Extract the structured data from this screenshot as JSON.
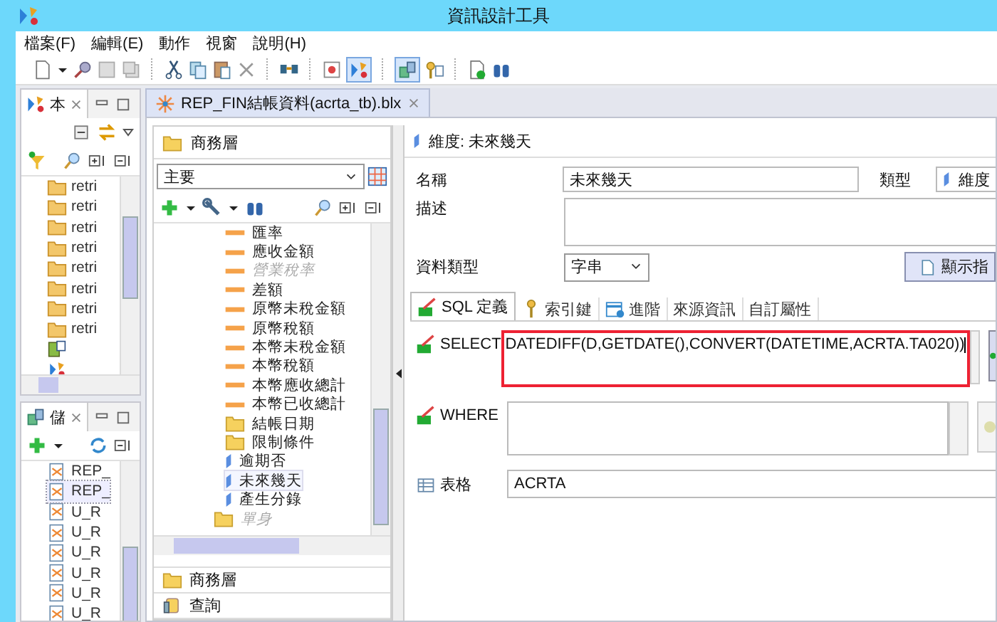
{
  "window": {
    "title": "資訊設計工具"
  },
  "menu": [
    "檔案(F)",
    "編輯(E)",
    "動作",
    "視窗",
    "說明(H)"
  ],
  "top_view": {
    "title": "本",
    "items": [
      "retri",
      "retri",
      "retri",
      "retri",
      "retri",
      "retri",
      "retri",
      "retri"
    ]
  },
  "bottom_view": {
    "title": "儲",
    "items": [
      {
        "label": "REP_",
        "selected": false
      },
      {
        "label": "REP_",
        "selected": true
      },
      {
        "label": "U_R",
        "selected": false
      },
      {
        "label": "U_R",
        "selected": false
      },
      {
        "label": "U_R",
        "selected": false
      },
      {
        "label": "U_R",
        "selected": false
      },
      {
        "label": "U_R",
        "selected": false
      },
      {
        "label": "U_R",
        "selected": false
      }
    ]
  },
  "editor_tab": {
    "label": "REP_FIN結帳資料(acrta_tb).blx"
  },
  "business_layer": {
    "title": "商務層",
    "combo": "主要",
    "tree": {
      "inner": [
        {
          "label": "匯率",
          "kind": "measure",
          "disabled": false,
          "selected": false
        },
        {
          "label": "應收金額",
          "kind": "measure",
          "disabled": false,
          "selected": false
        },
        {
          "label": "營業稅率",
          "kind": "measure",
          "disabled": true,
          "selected": false
        },
        {
          "label": "差額",
          "kind": "measure",
          "disabled": false,
          "selected": false
        },
        {
          "label": "原幣未稅金額",
          "kind": "measure",
          "disabled": false,
          "selected": false
        },
        {
          "label": "原幣稅額",
          "kind": "measure",
          "disabled": false,
          "selected": false
        },
        {
          "label": "本幣未稅金額",
          "kind": "measure",
          "disabled": false,
          "selected": false
        },
        {
          "label": "本幣稅額",
          "kind": "measure",
          "disabled": false,
          "selected": false
        },
        {
          "label": "本幣應收總計",
          "kind": "measure",
          "disabled": false,
          "selected": false
        },
        {
          "label": "本幣已收總計",
          "kind": "measure",
          "disabled": false,
          "selected": false
        },
        {
          "label": "結帳日期",
          "kind": "folder",
          "disabled": false,
          "selected": false
        },
        {
          "label": "限制條件",
          "kind": "folder",
          "disabled": false,
          "selected": false
        },
        {
          "label": "逾期否",
          "kind": "dimension",
          "disabled": false,
          "selected": false
        },
        {
          "label": "未來幾天",
          "kind": "dimension",
          "disabled": false,
          "selected": true
        },
        {
          "label": "產生分錄",
          "kind": "dimension",
          "disabled": false,
          "selected": false
        }
      ],
      "outer": [
        {
          "label": "單身",
          "kind": "folder",
          "disabled": true,
          "selected": false
        }
      ]
    },
    "sections": [
      {
        "label": "商務層",
        "kind": "folder"
      },
      {
        "label": "查詢",
        "kind": "query"
      }
    ]
  },
  "properties": {
    "header": "維度: 未來幾天",
    "name_label": "名稱",
    "name": "未來幾天",
    "type_label": "類型",
    "type": "維度",
    "description_label": "描述",
    "datatype_label": "資料類型",
    "datatype": "字串",
    "show_button": "顯示指",
    "tabs": [
      {
        "label": "SQL 定義",
        "selected": true
      },
      {
        "label": "索引鍵",
        "selected": false
      },
      {
        "label": "進階",
        "selected": false
      },
      {
        "label": "來源資訊",
        "selected": false
      },
      {
        "label": "自訂屬性",
        "selected": false
      }
    ],
    "select_label": "SELECT",
    "select": "DATEDIFF(D,GETDATE(),CONVERT(DATETIME,ACRTA.TA020))",
    "where_label": "WHERE",
    "table_label": "表格",
    "table": "ACRTA"
  }
}
